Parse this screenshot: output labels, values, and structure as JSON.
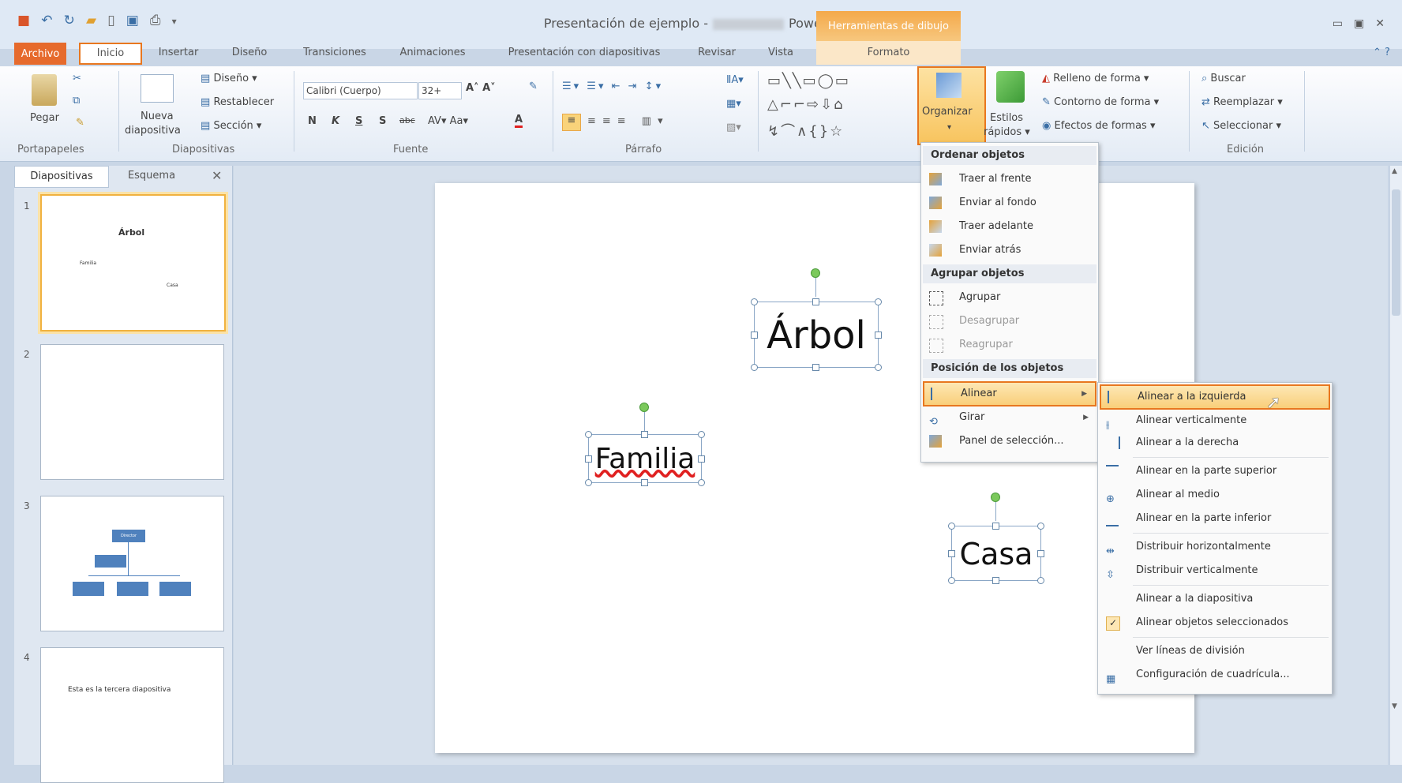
{
  "title": {
    "doc": "Presentación de ejemplo",
    "sep": "-",
    "app": "PowerPoint",
    "context_tab": "Herramientas de dibujo"
  },
  "tabs": [
    "Archivo",
    "Inicio",
    "Insertar",
    "Diseño",
    "Transiciones",
    "Animaciones",
    "Presentación con diapositivas",
    "Revisar",
    "Vista",
    "Formato"
  ],
  "ribbon": {
    "portapapeles": {
      "paste": "Pegar",
      "label": "Portapapeles"
    },
    "diapositivas": {
      "nueva": "Nueva",
      "nueva2": "diapositiva",
      "diseno": "Diseño",
      "restablecer": "Restablecer",
      "seccion": "Sección",
      "label": "Diapositivas"
    },
    "fuente": {
      "font": "Calibri (Cuerpo)",
      "size": "32+",
      "label": "Fuente",
      "bold": "N",
      "italic": "K",
      "underline": "S",
      "shadow": "S",
      "strike": "abc"
    },
    "parrafo": {
      "label": "Párrafo"
    },
    "dibujo": {
      "organizar": "Organizar",
      "estilos": "Estilos",
      "rapidos": "rápidos",
      "relleno": "Relleno de forma",
      "contorno": "Contorno de forma",
      "efectos": "Efectos de formas"
    },
    "edicion": {
      "buscar": "Buscar",
      "reemplazar": "Reemplazar",
      "seleccionar": "Seleccionar",
      "label": "Edición"
    }
  },
  "panel": {
    "tab1": "Diapositivas",
    "tab2": "Esquema",
    "close": "✕",
    "slides": [
      {
        "num": "1",
        "texts": [
          "Árbol",
          "Familia",
          "Casa"
        ]
      },
      {
        "num": "2"
      },
      {
        "num": "3",
        "org_top": "Director"
      },
      {
        "num": "4",
        "text": "Esta es la tercera diapositiva"
      }
    ]
  },
  "slide": {
    "shapes": [
      "Árbol",
      "Familia",
      "Casa"
    ]
  },
  "menu_organizar": {
    "h1": "Ordenar objetos",
    "i1": "Traer al frente",
    "i2": "Enviar al fondo",
    "i3": "Traer adelante",
    "i4": "Enviar atrás",
    "h2": "Agrupar objetos",
    "i5": "Agrupar",
    "i6": "Desagrupar",
    "i7": "Reagrupar",
    "h3": "Posición de los objetos",
    "i8": "Alinear",
    "i9": "Girar",
    "i10": "Panel de selección..."
  },
  "submenu_alinear": [
    "Alinear a la izquierda",
    "Alinear verticalmente",
    "Alinear a la derecha",
    "Alinear en la parte superior",
    "Alinear al medio",
    "Alinear en la parte inferior",
    "Distribuir horizontalmente",
    "Distribuir verticalmente",
    "Alinear a la diapositiva",
    "Alinear objetos seleccionados",
    "Ver líneas de división",
    "Configuración de cuadrícula..."
  ]
}
